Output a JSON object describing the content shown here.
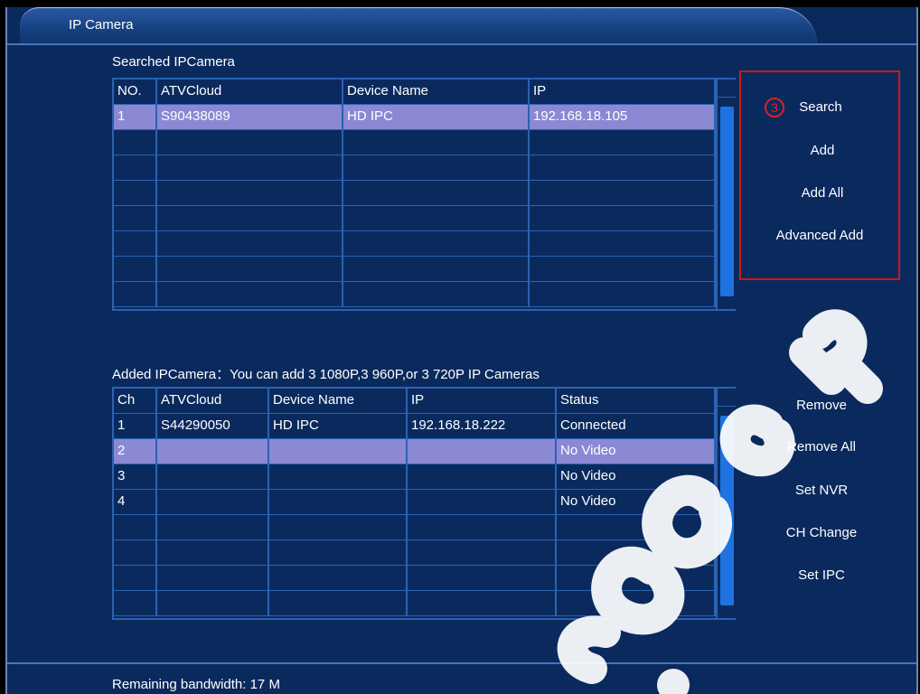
{
  "window": {
    "title": "IP Camera"
  },
  "searched": {
    "section_label": "Searched IPCamera",
    "headers": [
      "NO.",
      "ATVCloud",
      "Device Name",
      "IP"
    ],
    "rows": [
      [
        "1",
        "S90438089",
        "HD IPC",
        "192.168.18.105"
      ],
      [
        "",
        "",
        "",
        ""
      ],
      [
        "",
        "",
        "",
        ""
      ],
      [
        "",
        "",
        "",
        ""
      ],
      [
        "",
        "",
        "",
        ""
      ],
      [
        "",
        "",
        "",
        ""
      ],
      [
        "",
        "",
        "",
        ""
      ],
      [
        "",
        "",
        "",
        ""
      ]
    ],
    "selected_row": 0
  },
  "search_panel": {
    "step_marker": "3",
    "search_label": "Search",
    "add_label": "Add",
    "add_all_label": "Add All",
    "advanced_add_label": "Advanced Add"
  },
  "added": {
    "section_label": "Added IPCamera：You can add 3 1080P,3 960P,or 3 720P IP Cameras",
    "headers": [
      "Ch",
      "ATVCloud",
      "Device Name",
      "IP",
      "Status"
    ],
    "rows": [
      [
        "1",
        "S44290050",
        "HD IPC",
        "192.168.18.222",
        "Connected"
      ],
      [
        "2",
        "",
        "",
        "",
        "No Video"
      ],
      [
        "3",
        "",
        "",
        "",
        "No Video"
      ],
      [
        "4",
        "",
        "",
        "",
        "No Video"
      ],
      [
        "",
        "",
        "",
        "",
        ""
      ],
      [
        "",
        "",
        "",
        "",
        ""
      ],
      [
        "",
        "",
        "",
        "",
        ""
      ],
      [
        "",
        "",
        "",
        "",
        ""
      ]
    ],
    "selected_row": 1
  },
  "actions": {
    "remove_label": "Remove",
    "remove_all_label": "Remove All",
    "set_nvr_label": "Set NVR",
    "ch_change_label": "CH Change",
    "set_ipc_label": "Set IPC"
  },
  "status": {
    "bandwidth_text": "Remaining bandwidth: 17 M"
  },
  "colors": {
    "background": "#0a2a5e",
    "grid_line": "#2b62b2",
    "selected_row": "#8b88d4",
    "scroll_thumb": "#1e73e0",
    "highlight_box": "#d01818"
  }
}
